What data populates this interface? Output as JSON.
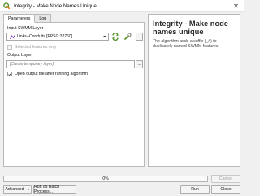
{
  "window": {
    "title": "Integrity - Make Node Names Unique",
    "app_icon": "qgis-logo-icon",
    "close_icon": "close-icon",
    "close_glyph": "✕"
  },
  "tabs": [
    {
      "label": "Parameters",
      "active": true
    },
    {
      "label": "Log",
      "active": false
    }
  ],
  "parameters": {
    "input_layer_label": "Input SWMM Layer",
    "input_layer_value": "Links--Conduits [EPSG:32760]",
    "input_layer_icon": "line-layer-icon",
    "iterate_icon": "iterate-features-icon",
    "wrench_icon": "wrench-icon",
    "browse_label": "...",
    "selected_only_label": "Selected features only",
    "selected_only_checked": false,
    "selected_only_enabled": false,
    "output_layer_label": "Output Layer",
    "output_layer_placeholder": "[Create temporary layer]",
    "output_browse_label": "...",
    "open_output_label": "Open output file after running algorithm",
    "open_output_checked": true
  },
  "help": {
    "title": "Integrity - Make node names unique",
    "description": "The algorithm adds a suffix (_#) to duplicately named SWMM features"
  },
  "footer": {
    "progress_text": "0%",
    "progress_value": 0,
    "cancel_label": "Cancel",
    "advanced_label": "Advanced",
    "batch_label": "Run as Batch Process...",
    "run_label": "Run",
    "close_label": "Close"
  },
  "colors": {
    "qgis_green": "#589632",
    "qgis_yellow": "#ee7913",
    "layer_purple": "#7a3db8"
  }
}
